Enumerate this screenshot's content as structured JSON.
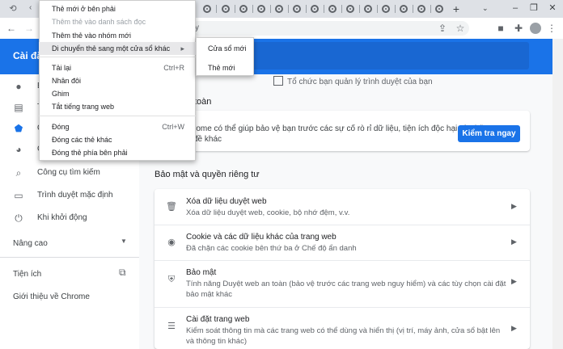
{
  "header": {
    "title": "Cài đặ"
  },
  "omnibox": {
    "text": "cy"
  },
  "sidebar": {
    "items": [
      {
        "label": "B",
        "icon": "person-icon"
      },
      {
        "label": "T",
        "icon": "clipboard-icon"
      },
      {
        "label": "Q",
        "icon": "shield-icon"
      },
      {
        "label": "Gi",
        "icon": "palette-icon"
      },
      {
        "label": "Công cụ tìm kiếm",
        "icon": "search-icon"
      },
      {
        "label": "Trình duyệt mặc định",
        "icon": "browser-icon"
      },
      {
        "label": "Khi khởi động",
        "icon": "power-icon"
      }
    ],
    "advanced": "Nâng cao",
    "extensions": "Tiện ích",
    "about": "Giới thiệu về Chrome"
  },
  "main": {
    "managed_text": "Tổ chức bạn quản lý trình duyệt của bạn",
    "safety_label": "toàn",
    "safety_line1": "rome có thể giúp bảo vệ bạn trước các sự cố rò rỉ dữ liệu, tiện ích độc hại và những",
    "safety_line2": "đề khác",
    "check_button": "Kiểm tra ngay",
    "privacy_label": "Bảo mật và quyền riêng tư",
    "privacy_rows": [
      {
        "title": "Xóa dữ liệu duyệt web",
        "subtitle": "Xóa dữ liệu duyệt web, cookie, bộ nhớ đệm, v.v.",
        "icon": "trash-icon"
      },
      {
        "title": "Cookie và các dữ liệu khác của trang web",
        "subtitle": "Đã chặn các cookie bên thứ ba ở Chế độ ẩn danh",
        "icon": "cookie-icon"
      },
      {
        "title": "Bảo mật",
        "subtitle": "Tính năng Duyệt web an toàn (bảo vệ trước các trang web nguy hiểm) và các tùy chọn cài đặt bảo mật khác",
        "icon": "security-shield-icon"
      },
      {
        "title": "Cài đặt trang web",
        "subtitle": "Kiểm soát thông tin mà các trang web có thể dùng và hiển thị (vị trí, máy ảnh, cửa sổ bật lên và thông tin khác)",
        "icon": "sliders-icon"
      }
    ]
  },
  "context_menu": {
    "items": [
      {
        "label": "Thẻ mới ở bên phải",
        "shortcut": ""
      },
      {
        "label": "Thêm thẻ vào danh sách đọc",
        "shortcut": "",
        "disabled": true
      },
      {
        "label": "Thêm thẻ vào nhóm mới",
        "shortcut": ""
      },
      {
        "label": "Di chuyển thẻ sang một cửa sổ khác",
        "shortcut": "",
        "submenu": true
      },
      {
        "label": "Tải lại",
        "shortcut": "Ctrl+R"
      },
      {
        "label": "Nhân đôi",
        "shortcut": ""
      },
      {
        "label": "Ghim",
        "shortcut": ""
      },
      {
        "label": "Tắt tiếng trang web",
        "shortcut": ""
      },
      {
        "label": "Đóng",
        "shortcut": "Ctrl+W"
      },
      {
        "label": "Đóng các thẻ khác",
        "shortcut": ""
      },
      {
        "label": "Đóng thẻ phía bên phải",
        "shortcut": ""
      }
    ],
    "submenu_items": [
      "Cửa sổ mới",
      "Thẻ mới"
    ]
  },
  "colors": {
    "accent": "#1a73e8",
    "header": "#1a73e8",
    "tabstrip": "#dee1e6"
  }
}
